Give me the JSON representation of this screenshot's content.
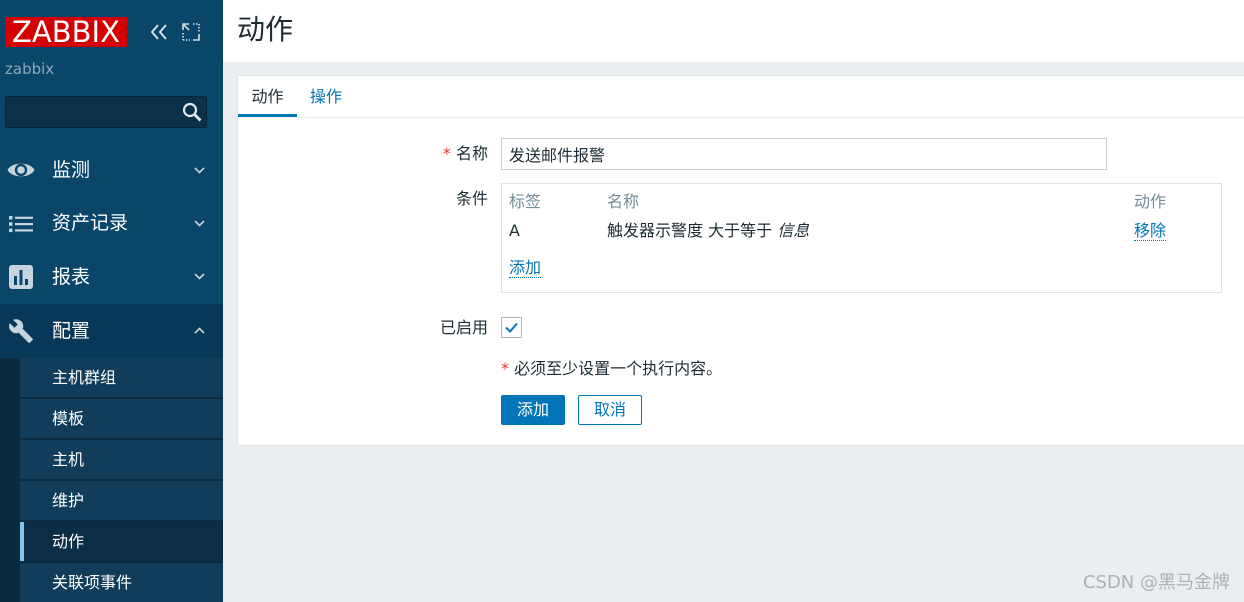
{
  "sidebar": {
    "logo_text": "ZABBIX",
    "server_name": "zabbix",
    "menu": [
      {
        "label": "监测",
        "icon": "eye-icon",
        "expanded": false
      },
      {
        "label": "资产记录",
        "icon": "list-icon",
        "expanded": false
      },
      {
        "label": "报表",
        "icon": "bar-chart-icon",
        "expanded": false
      },
      {
        "label": "配置",
        "icon": "wrench-icon",
        "expanded": true
      }
    ],
    "submenu": [
      {
        "label": "主机群组",
        "active": false
      },
      {
        "label": "模板",
        "active": false
      },
      {
        "label": "主机",
        "active": false
      },
      {
        "label": "维护",
        "active": false
      },
      {
        "label": "动作",
        "active": true
      },
      {
        "label": "关联项事件",
        "active": false
      }
    ]
  },
  "header": {
    "title": "动作"
  },
  "tabs": [
    {
      "label": "动作",
      "active": true
    },
    {
      "label": "操作",
      "active": false
    }
  ],
  "form": {
    "name": {
      "required_mark": "*",
      "label": "名称",
      "value": "发送邮件报警"
    },
    "conditions": {
      "label": "条件",
      "columns": {
        "tag": "标签",
        "name": "名称",
        "action": "动作"
      },
      "rows": [
        {
          "tag": "A",
          "condition": "触发器示警度",
          "operator": "大于等于",
          "value": "信息",
          "action": "移除"
        }
      ],
      "add_link": "添加"
    },
    "enabled": {
      "label": "已启用",
      "checked": true
    },
    "notice": {
      "required_mark": "*",
      "text": "必须至少设置一个执行内容。"
    },
    "buttons": {
      "submit": "添加",
      "cancel": "取消"
    }
  },
  "watermark": "CSDN @黑马金牌",
  "colors": {
    "accent": "#0275b8",
    "brand_red": "#d40000",
    "sidebar": "#0a466a",
    "required": "#e33734"
  }
}
